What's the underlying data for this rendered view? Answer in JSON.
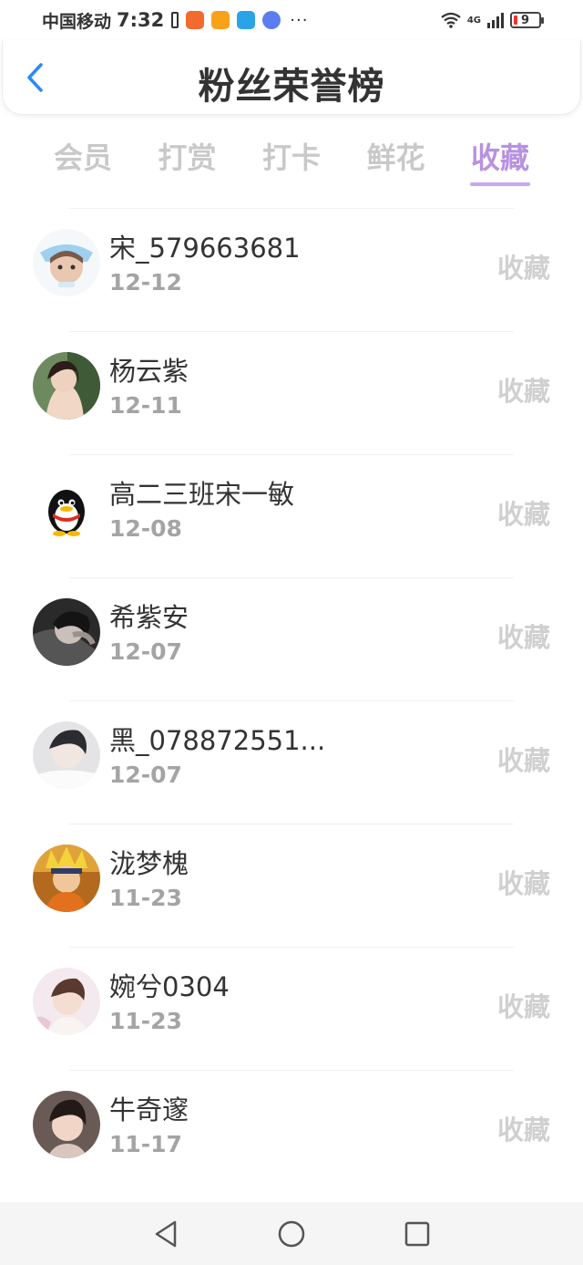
{
  "status_bar": {
    "carrier": "中国移动",
    "time": "7:32",
    "more": "···",
    "network": "4G",
    "battery": "9"
  },
  "header": {
    "title": "粉丝荣誉榜"
  },
  "tabs": [
    {
      "label": "会员",
      "active": false
    },
    {
      "label": "打赏",
      "active": false
    },
    {
      "label": "打卡",
      "active": false
    },
    {
      "label": "鲜花",
      "active": false
    },
    {
      "label": "收藏",
      "active": true
    }
  ],
  "fans": [
    {
      "name": "宋_579663681",
      "date": "12-12",
      "action": "收藏",
      "avatar": "cartoon-avatar"
    },
    {
      "name": "杨云紫",
      "date": "12-11",
      "action": "收藏",
      "avatar": "photo-avatar"
    },
    {
      "name": "高二三班宋一敏",
      "date": "12-08",
      "action": "收藏",
      "avatar": "penguin-avatar"
    },
    {
      "name": "希紫安",
      "date": "12-07",
      "action": "收藏",
      "avatar": "photo-avatar"
    },
    {
      "name": "黑_078872551...",
      "date": "12-07",
      "action": "收藏",
      "avatar": "photo-avatar"
    },
    {
      "name": "泷梦槐",
      "date": "11-23",
      "action": "收藏",
      "avatar": "anime-avatar"
    },
    {
      "name": "婉兮0304",
      "date": "11-23",
      "action": "收藏",
      "avatar": "photo-avatar"
    },
    {
      "name": "牛奇邃",
      "date": "11-17",
      "action": "收藏",
      "avatar": "photo-avatar"
    }
  ],
  "colors": {
    "accent": "#b892e0",
    "back_arrow": "#2a8bf2",
    "inactive_tab": "#c9c9c9",
    "secondary_text": "#a4a4a4"
  }
}
